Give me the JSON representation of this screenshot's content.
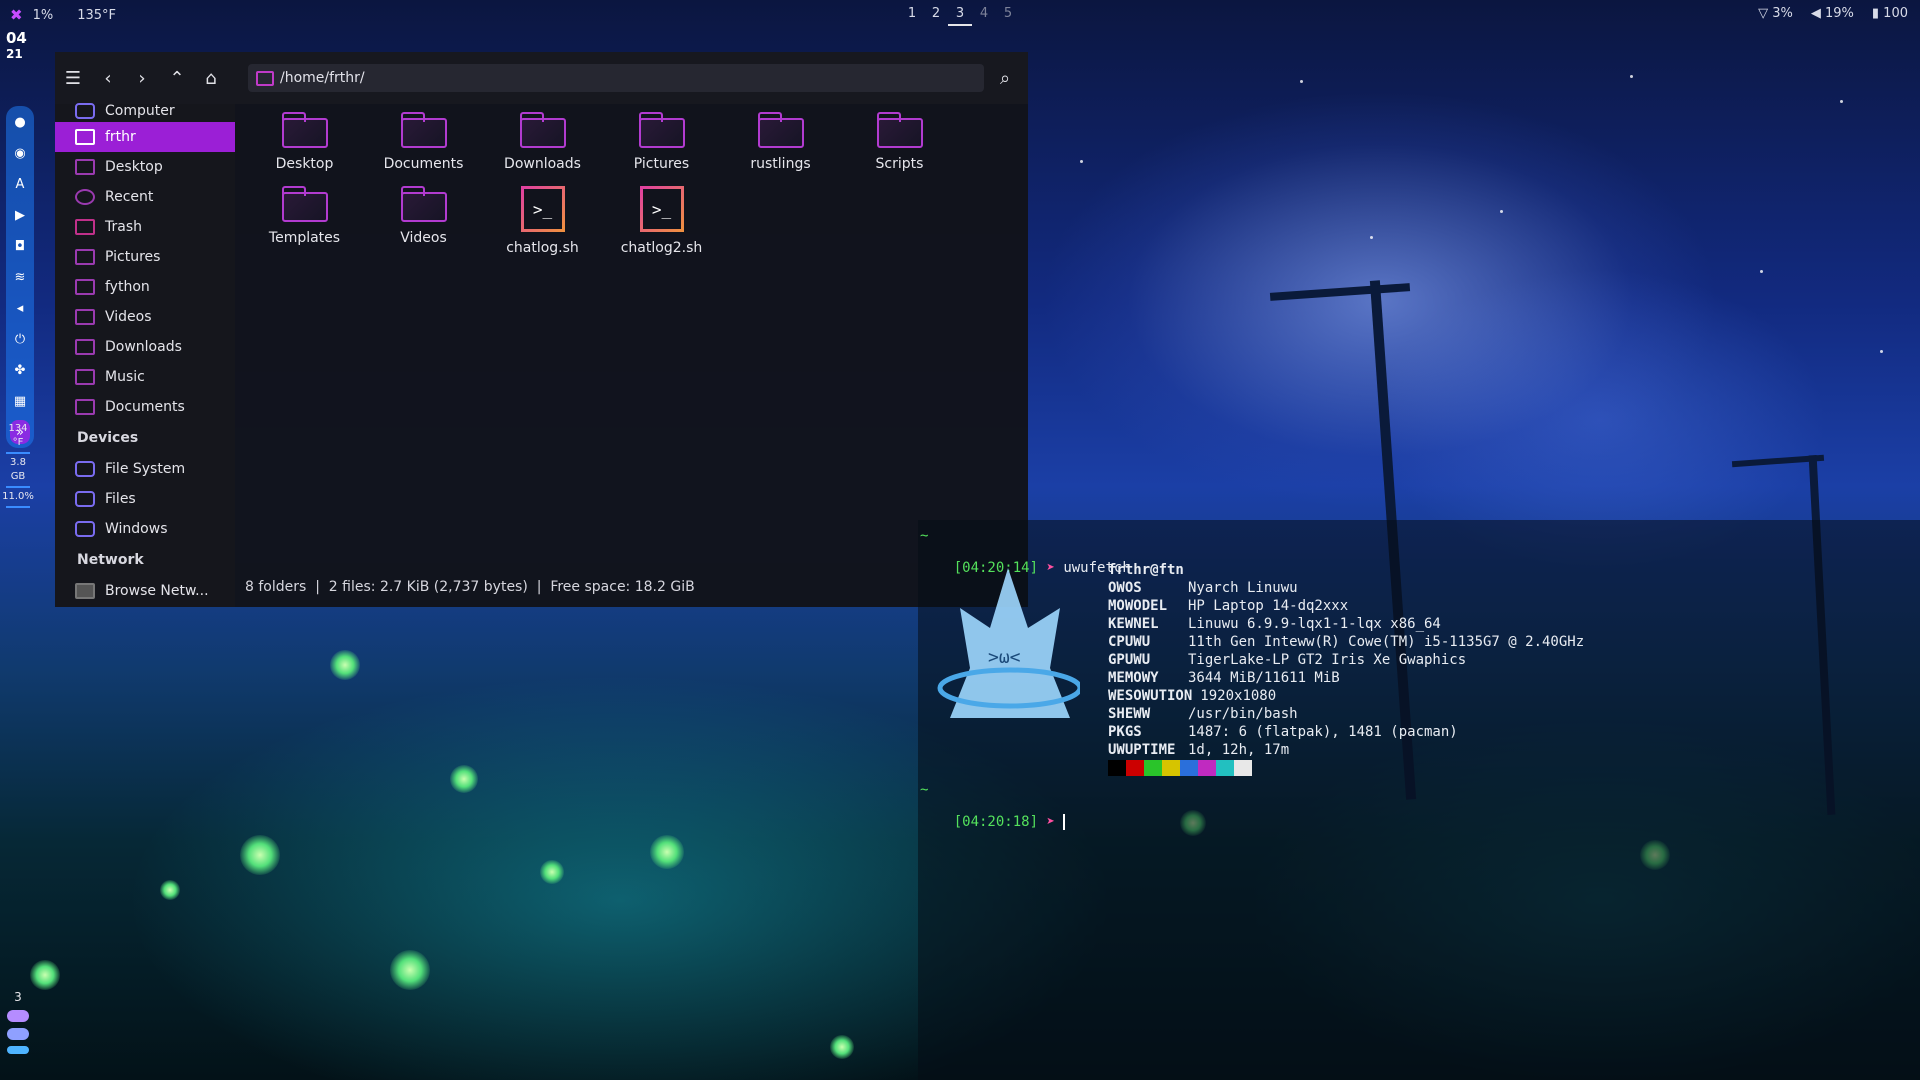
{
  "topbar": {
    "cpu": "1%",
    "temp": "135°F",
    "workspaces": [
      "1",
      "2",
      "3",
      "4",
      "5"
    ],
    "wifi": "3%",
    "volume": "19%",
    "battery": "100"
  },
  "dock": {
    "clock_hour": "04",
    "clock_min": "21",
    "temp_value": "134",
    "temp_unit": "°F",
    "mem": "3.8 GB",
    "cpu": "11.0%",
    "workspace_num": "3"
  },
  "file_manager": {
    "path": "/home/frthr/",
    "sidebar": {
      "places": [
        "Computer",
        "frthr",
        "Desktop",
        "Recent",
        "Trash",
        "Pictures",
        "fython",
        "Videos",
        "Downloads",
        "Music",
        "Documents"
      ],
      "devices_header": "Devices",
      "devices": [
        "File System",
        "Files",
        "Windows"
      ],
      "network_header": "Network",
      "network": [
        "Browse Netw..."
      ]
    },
    "items": [
      {
        "name": "Desktop",
        "type": "folder"
      },
      {
        "name": "Documents",
        "type": "folder"
      },
      {
        "name": "Downloads",
        "type": "folder"
      },
      {
        "name": "Pictures",
        "type": "folder"
      },
      {
        "name": "rustlings",
        "type": "folder"
      },
      {
        "name": "Scripts",
        "type": "folder"
      },
      {
        "name": "Templates",
        "type": "folder"
      },
      {
        "name": "Videos",
        "type": "folder"
      },
      {
        "name": "chatlog.sh",
        "type": "script"
      },
      {
        "name": "chatlog2.sh",
        "type": "script"
      }
    ],
    "status": "8 folders  |  2 files: 2.7 KiB (2,737 bytes)  |  Free space: 18.2 GiB"
  },
  "terminal": {
    "tilde": "~",
    "prompt1_time": "[04:20:14]",
    "arrow": "➤",
    "command": "uwufetch",
    "userhost": "frthr@ftn",
    "info": [
      {
        "key": "OWOS",
        "value": "Nyarch Linuwu"
      },
      {
        "key": "MOWODEL",
        "value": "HP Laptop 14-dq2xxx"
      },
      {
        "key": "KEWNEL",
        "value": "Linuwu 6.9.9-lqx1-1-lqx x86_64"
      },
      {
        "key": "CPUWU",
        "value": "11th Gen Inteww(R) Cowe(TM) i5-1135G7 @ 2.40GHz"
      },
      {
        "key": "GPUWU",
        "value": "TigerLake-LP GT2 Iris Xe Gwaphics"
      },
      {
        "key": "MEMOWY",
        "value": "3644 MiB/11611 MiB"
      },
      {
        "key": "WESOWUTION",
        "value": "1920x1080"
      },
      {
        "key": "SHEWW",
        "value": "/usr/bin/bash"
      },
      {
        "key": "PKGS",
        "value": "1487: 6 (flatpak), 1481 (pacman)"
      },
      {
        "key": "UWUPTIME",
        "value": "1d, 12h, 17m"
      }
    ],
    "palette": [
      "#000000",
      "#cc0000",
      "#2ac42a",
      "#d6c400",
      "#2a6fdb",
      "#c02ac0",
      "#22c0c0",
      "#e8e8e8"
    ],
    "prompt2_time": "[04:20:18]"
  },
  "colors": {
    "accent": "#9b1fd6",
    "folder": "#b23bd0",
    "prompt_time": "#54e15c",
    "prompt_arrow": "#ff4fa0"
  }
}
